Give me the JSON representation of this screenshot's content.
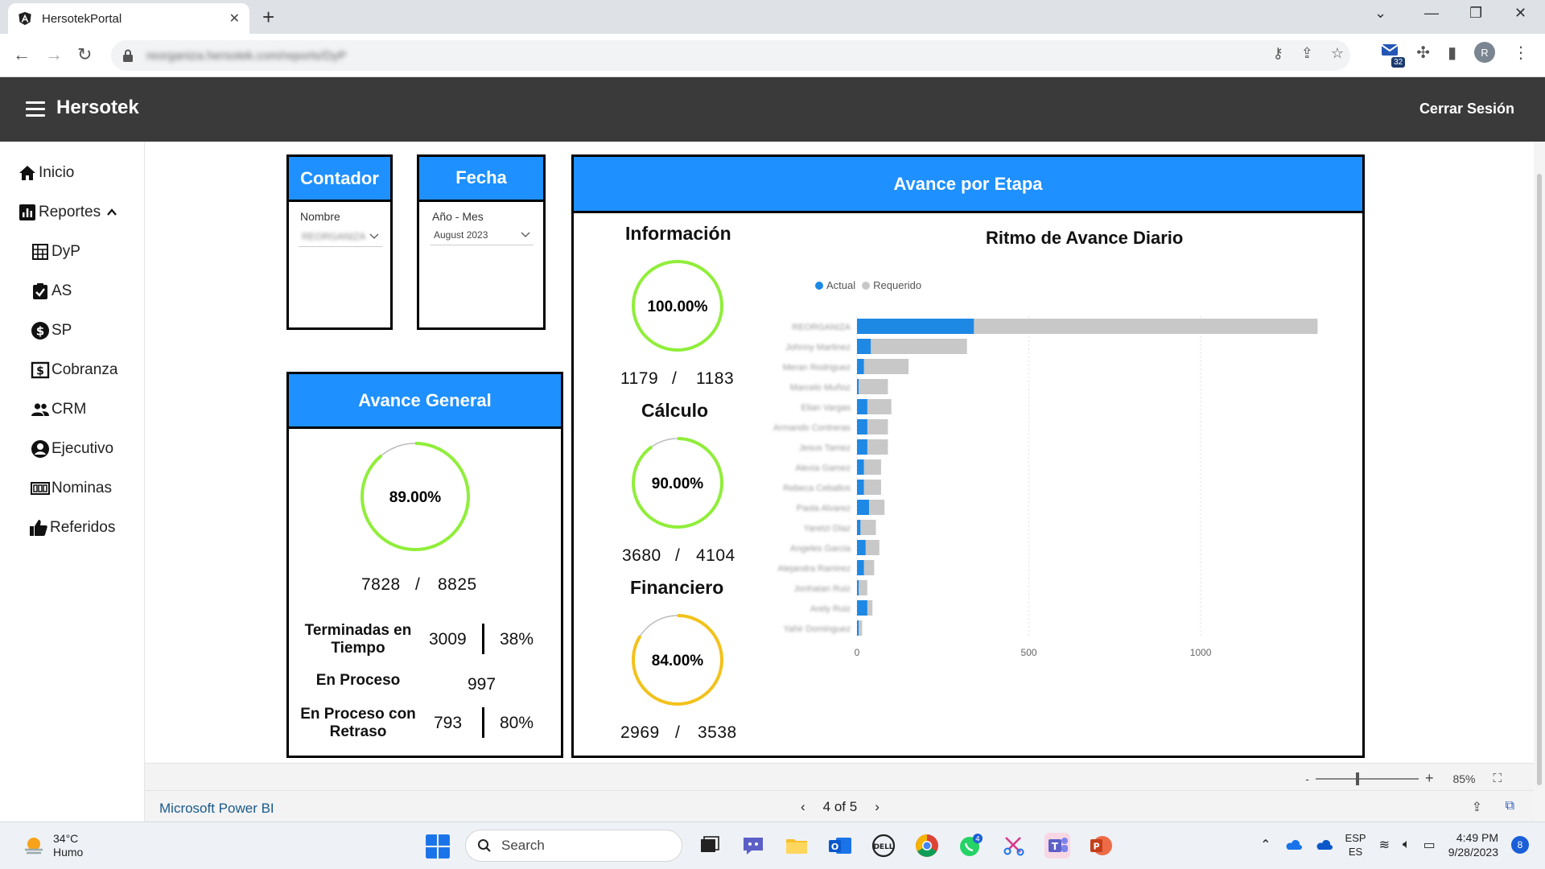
{
  "browser": {
    "tab_title": "HersotekPortal",
    "url": "reorganiza.hersotek.com/reports/DyP",
    "extension_badge": "32",
    "profile_initial": "R"
  },
  "app": {
    "brand": "Hersotek",
    "logout_label": "Cerrar Sesión"
  },
  "sidebar": {
    "items": [
      {
        "label": "Inicio",
        "icon": "home-icon"
      },
      {
        "label": "Reportes",
        "icon": "bar-chart-icon"
      },
      {
        "label": "DyP",
        "icon": "spreadsheet-icon"
      },
      {
        "label": "AS",
        "icon": "clipboard-check-icon"
      },
      {
        "label": "SP",
        "icon": "dollar-circle-icon"
      },
      {
        "label": "Cobranza",
        "icon": "dollar-bill-icon"
      },
      {
        "label": "CRM",
        "icon": "people-icon"
      },
      {
        "label": "Ejecutivo",
        "icon": "user-circle-icon"
      },
      {
        "label": "Nominas",
        "icon": "payroll-icon"
      },
      {
        "label": "Referidos",
        "icon": "thumbs-up-icon"
      }
    ]
  },
  "report": {
    "contador": {
      "title": "Contador",
      "field_label": "Nombre",
      "value": "REORGANIZA"
    },
    "fecha": {
      "title": "Fecha",
      "field_label": "Año - Mes",
      "value": "August 2023"
    },
    "avance_general": {
      "title": "Avance General",
      "percent_label": "89.00%",
      "percent": 89,
      "done": "7828",
      "total": "8825",
      "stats": {
        "terminadas_label": "Terminadas en Tiempo",
        "terminadas_value": "3009",
        "terminadas_pct": "38%",
        "proceso_label": "En Proceso",
        "proceso_value": "997",
        "retraso_label": "En Proceso con Retraso",
        "retraso_value": "793",
        "retraso_pct": "80%"
      }
    },
    "avance_etapa": {
      "title": "Avance por Etapa",
      "stages": [
        {
          "title": "Información",
          "percent_label": "100.00%",
          "percent": 100,
          "done": "1179",
          "total": "1183",
          "color": "#90ee3a"
        },
        {
          "title": "Cálculo",
          "percent_label": "90.00%",
          "percent": 90,
          "done": "3680",
          "total": "4104",
          "color": "#90ee3a"
        },
        {
          "title": "Financiero",
          "percent_label": "84.00%",
          "percent": 84,
          "done": "2969",
          "total": "3538",
          "color": "#f2c21b"
        }
      ],
      "separator": "/"
    }
  },
  "chart_data": {
    "type": "bar",
    "orientation": "horizontal",
    "title": "Ritmo de Avance Diario",
    "legend_position": "top-left",
    "series": [
      {
        "name": "Actual",
        "color": "#1e88e5",
        "values": [
          340,
          40,
          20,
          5,
          30,
          30,
          30,
          20,
          20,
          35,
          10,
          25,
          20,
          5,
          30,
          5
        ]
      },
      {
        "name": "Requerido",
        "color": "#c8c8c8",
        "values": [
          1340,
          320,
          150,
          90,
          100,
          90,
          90,
          70,
          70,
          80,
          55,
          65,
          50,
          30,
          45,
          15
        ]
      }
    ],
    "categories": [
      "REORGANIZA",
      "Johnny Martinez",
      "Meran Rodriguez",
      "Marcelo Muñoz",
      "Elian Vargas",
      "Armando Contreras",
      "Jesus Tamez",
      "Alexia Gamez",
      "Rebeca Ceballos",
      "Paola Alvarez",
      "Yaretzi Diaz",
      "Angeles Garcia",
      "Alejandra Ramirez",
      "Jonhatan Ruiz",
      "Arely Ruiz",
      "Yahir Dominguez"
    ],
    "x_ticks": [
      "0",
      "500",
      "1000"
    ],
    "xlim": [
      0,
      1400
    ],
    "grid": true
  },
  "pbi": {
    "brand": "Microsoft Power BI",
    "page_indicator": "4 of 5",
    "zoom": "85%",
    "zoom_minus": "-",
    "zoom_plus": "+"
  },
  "taskbar": {
    "temperature": "34°C",
    "weather_desc": "Humo",
    "search_placeholder": "Search",
    "whatsapp_badge": "4",
    "lang_top": "ESP",
    "lang_bottom": "ES",
    "time": "4:49 PM",
    "date": "9/28/2023",
    "notifications": "8"
  }
}
